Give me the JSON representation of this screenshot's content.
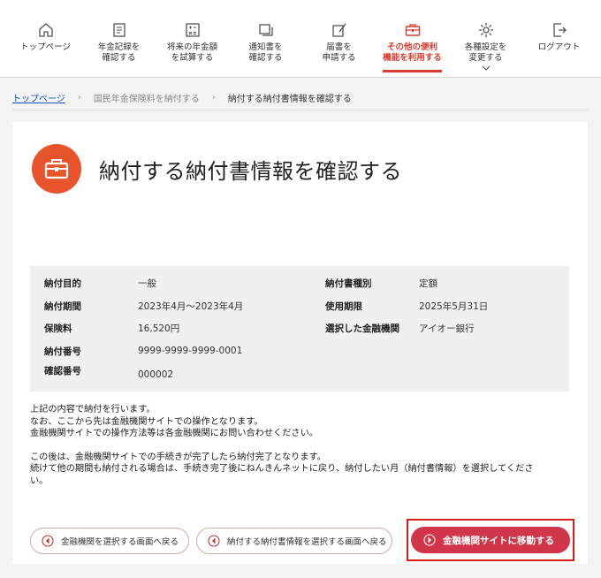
{
  "nav": {
    "items": [
      {
        "label": "トップページ",
        "icon": "home-icon"
      },
      {
        "label": "年金記録を\n確認する",
        "icon": "record-book-icon"
      },
      {
        "label": "将来の年金額\nを試算する",
        "icon": "calculator-icon"
      },
      {
        "label": "通知書を\n確認する",
        "icon": "document-stack-icon"
      },
      {
        "label": "届書を\n申請する",
        "icon": "form-edit-icon"
      },
      {
        "label": "その他の便利\n機能を利用する",
        "icon": "toolbox-icon"
      },
      {
        "label": "各種設定を\n変更する",
        "icon": "gear-icon"
      },
      {
        "label": "ログアウト",
        "icon": "logout-icon"
      }
    ],
    "active_index": 5,
    "accent_color": "#d93b2f"
  },
  "breadcrumb": {
    "home": "トップページ",
    "middle": "国民年金保険料を納付する",
    "current": "納付する納付書情報を確認する"
  },
  "page": {
    "title": "納付する納付書情報を確認する",
    "title_icon": "toolbox-icon",
    "icon_color": "#e8542b"
  },
  "info": {
    "purpose_label": "納付目的",
    "purpose_value": "一般",
    "type_label": "納付書種別",
    "type_value": "定額",
    "period_label": "納付期間",
    "period_value": "2023年4月～2023年4月",
    "expiry_label": "使用期限",
    "expiry_value": "2025年5月31日",
    "premium_label": "保険料",
    "premium_value": "16,520円",
    "bank_label": "選択した金融機関",
    "bank_value": "アイオー銀行",
    "payment_no_label": "納付番号",
    "payment_no_value": "9999-9999-9999-0001",
    "confirm_no_label": "確認番号",
    "confirm_no_value": "000002"
  },
  "messages": {
    "line1": "上記の内容で納付を行います。",
    "line2": "なお、ここから先は金融機関サイトでの操作となります。",
    "line3": "金融機関サイトでの操作方法等は各金融機関にお問い合わせください。",
    "line4": "この後は、金融機関サイトでの手続きが完了したら納付完了となります。",
    "line5": "続けて他の期間も納付される場合は、手続き完了後にねんきんネットに戻り、納付したい月（納付書情報）を選択してくださ",
    "line6": "い。"
  },
  "buttons": {
    "back_bank": "金融機関を選択する画面へ戻る",
    "back_slip": "納付する納付書情報を選択する画面へ戻る",
    "go_bank": "金融機関サイトに移動する",
    "primary_color": "#d0354a"
  }
}
